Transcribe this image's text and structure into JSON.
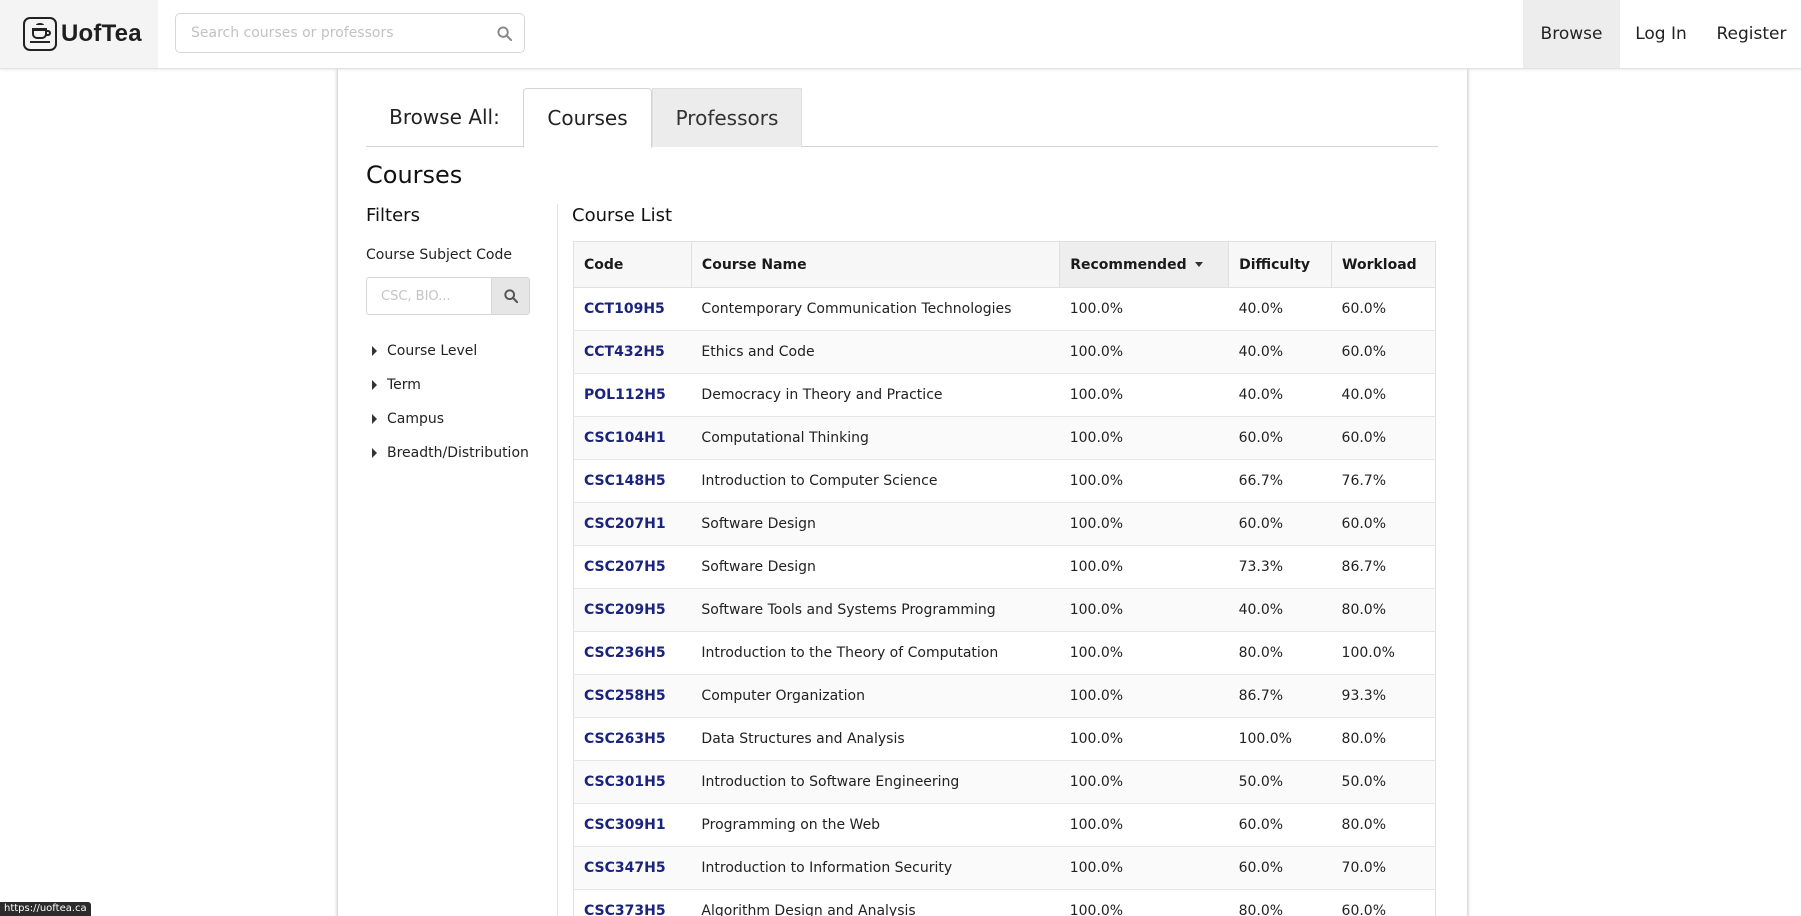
{
  "header": {
    "brand": "UofTea",
    "search_placeholder": "Search courses or professors",
    "nav": {
      "browse": "Browse",
      "login": "Log In",
      "register": "Register"
    }
  },
  "tabs": {
    "label": "Browse All:",
    "courses": "Courses",
    "professors": "Professors"
  },
  "page_title": "Courses",
  "filters": {
    "title": "Filters",
    "subject_label": "Course Subject Code",
    "subject_placeholder": "CSC, BIO...",
    "groups": [
      "Course Level",
      "Term",
      "Campus",
      "Breadth/Distribution"
    ]
  },
  "course_list": {
    "title": "Course List",
    "columns": [
      "Code",
      "Course Name",
      "Recommended",
      "Difficulty",
      "Workload"
    ],
    "rows": [
      [
        "CCT109H5",
        "Contemporary Communication Technologies",
        "100.0%",
        "40.0%",
        "60.0%"
      ],
      [
        "CCT432H5",
        "Ethics and Code",
        "100.0%",
        "40.0%",
        "60.0%"
      ],
      [
        "POL112H5",
        "Democracy in Theory and Practice",
        "100.0%",
        "40.0%",
        "40.0%"
      ],
      [
        "CSC104H1",
        "Computational Thinking",
        "100.0%",
        "60.0%",
        "60.0%"
      ],
      [
        "CSC148H5",
        "Introduction to Computer Science",
        "100.0%",
        "66.7%",
        "76.7%"
      ],
      [
        "CSC207H1",
        "Software Design",
        "100.0%",
        "60.0%",
        "60.0%"
      ],
      [
        "CSC207H5",
        "Software Design",
        "100.0%",
        "73.3%",
        "86.7%"
      ],
      [
        "CSC209H5",
        "Software Tools and Systems Programming",
        "100.0%",
        "40.0%",
        "80.0%"
      ],
      [
        "CSC236H5",
        "Introduction to the Theory of Computation",
        "100.0%",
        "80.0%",
        "100.0%"
      ],
      [
        "CSC258H5",
        "Computer Organization",
        "100.0%",
        "86.7%",
        "93.3%"
      ],
      [
        "CSC263H5",
        "Data Structures and Analysis",
        "100.0%",
        "100.0%",
        "80.0%"
      ],
      [
        "CSC301H5",
        "Introduction to Software Engineering",
        "100.0%",
        "50.0%",
        "50.0%"
      ],
      [
        "CSC309H1",
        "Programming on the Web",
        "100.0%",
        "60.0%",
        "80.0%"
      ],
      [
        "CSC347H5",
        "Introduction to Information Security",
        "100.0%",
        "60.0%",
        "70.0%"
      ],
      [
        "CSC373H5",
        "Algorithm Design and Analysis",
        "100.0%",
        "80.0%",
        "60.0%"
      ]
    ]
  },
  "status_url": "https://uoftea.ca"
}
